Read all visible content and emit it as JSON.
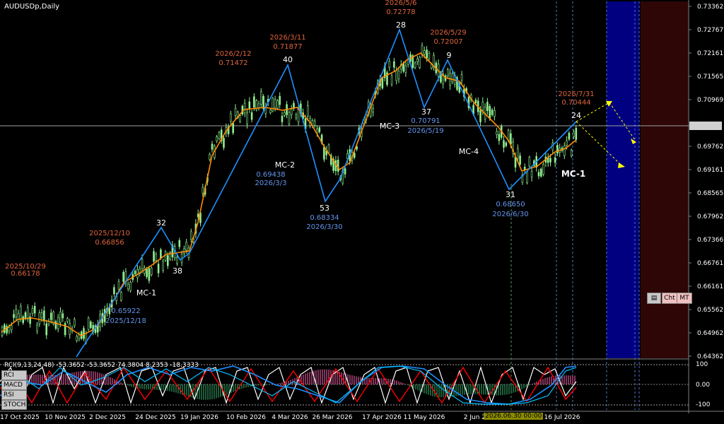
{
  "window": {
    "symbol_label": "AUDUSDp,Daily"
  },
  "indicator_info": "RCI(9,13,24,48) -53.3652 -53.3652 74.3804 8.2353 -18.3333",
  "indicator_buttons": [
    "RCI",
    "MACD",
    "RSI",
    "STOCH"
  ],
  "mini_panel": {
    "icon": "list-icon",
    "cht": "Cht",
    "mt": "MT"
  },
  "price_axis": {
    "labels": [
      "0.73362",
      "0.72767",
      "0.72161",
      "0.71565",
      "0.70969",
      "0.70294",
      "0.69762",
      "0.69161",
      "0.68565",
      "0.67962",
      "0.67366",
      "0.66761",
      "0.66161",
      "0.65562",
      "0.64962",
      "0.64362"
    ],
    "current_price": "0.70294"
  },
  "sub_axis": [
    "100",
    "0.00",
    "-100"
  ],
  "time_axis": [
    "17 Oct 2025",
    "10 Nov 2025",
    "2 Dec 2025",
    "24 Dec 2025",
    "19 Jan 2026",
    "10 Feb 2026",
    "4 Mar 2026",
    "26 Mar 2026",
    "17 Apr 2026",
    "11 May 2026",
    "2 Jun 2026",
    "16 Jul 2026"
  ],
  "time_cursor": "2026.06.30 00:00",
  "swing_labels": [
    {
      "text": "2025/10/29",
      "color": "red"
    },
    {
      "text": "0.66178",
      "color": "red"
    },
    {
      "text": "2025/12/10",
      "color": "red"
    },
    {
      "text": "0.66856",
      "color": "red"
    },
    {
      "text": "2026/2/12",
      "color": "red"
    },
    {
      "text": "0.71472",
      "color": "red"
    },
    {
      "text": "2026/3/11",
      "color": "red"
    },
    {
      "text": "0.71877",
      "color": "red"
    },
    {
      "text": "2026/5/6",
      "color": "red"
    },
    {
      "text": "0.72778",
      "color": "red"
    },
    {
      "text": "2026/5/29",
      "color": "red"
    },
    {
      "text": "0.72007",
      "color": "red"
    },
    {
      "text": "2026/7/31",
      "color": "red"
    },
    {
      "text": "0.70444",
      "color": "red"
    },
    {
      "text": "0.65922",
      "color": "blue"
    },
    {
      "text": "2025/12/18",
      "color": "blue"
    },
    {
      "text": "0.69438",
      "color": "blue"
    },
    {
      "text": "2026/3/3",
      "color": "blue"
    },
    {
      "text": "0.68334",
      "color": "blue"
    },
    {
      "text": "2026/3/30",
      "color": "blue"
    },
    {
      "text": "0.70791",
      "color": "blue"
    },
    {
      "text": "2026/5/19",
      "color": "blue"
    },
    {
      "text": "0.68650",
      "color": "blue"
    },
    {
      "text": "2026/6/30",
      "color": "blue"
    }
  ],
  "wave_counts": [
    "32",
    "38",
    "40",
    "53",
    "28",
    "37",
    "9",
    "31",
    "24"
  ],
  "mc_labels": [
    "MC-1",
    "MC-2",
    "MC-3",
    "MC-4",
    "MC-1"
  ],
  "colors": {
    "background": "#000000",
    "candle": "#90ee90",
    "zigzag": "#1e90ff",
    "ma": "#ff8c00",
    "red_text": "#e0643c",
    "blue_text": "#6495ed",
    "future_blue": "#000080",
    "future_red": "#3a0a0a"
  }
}
